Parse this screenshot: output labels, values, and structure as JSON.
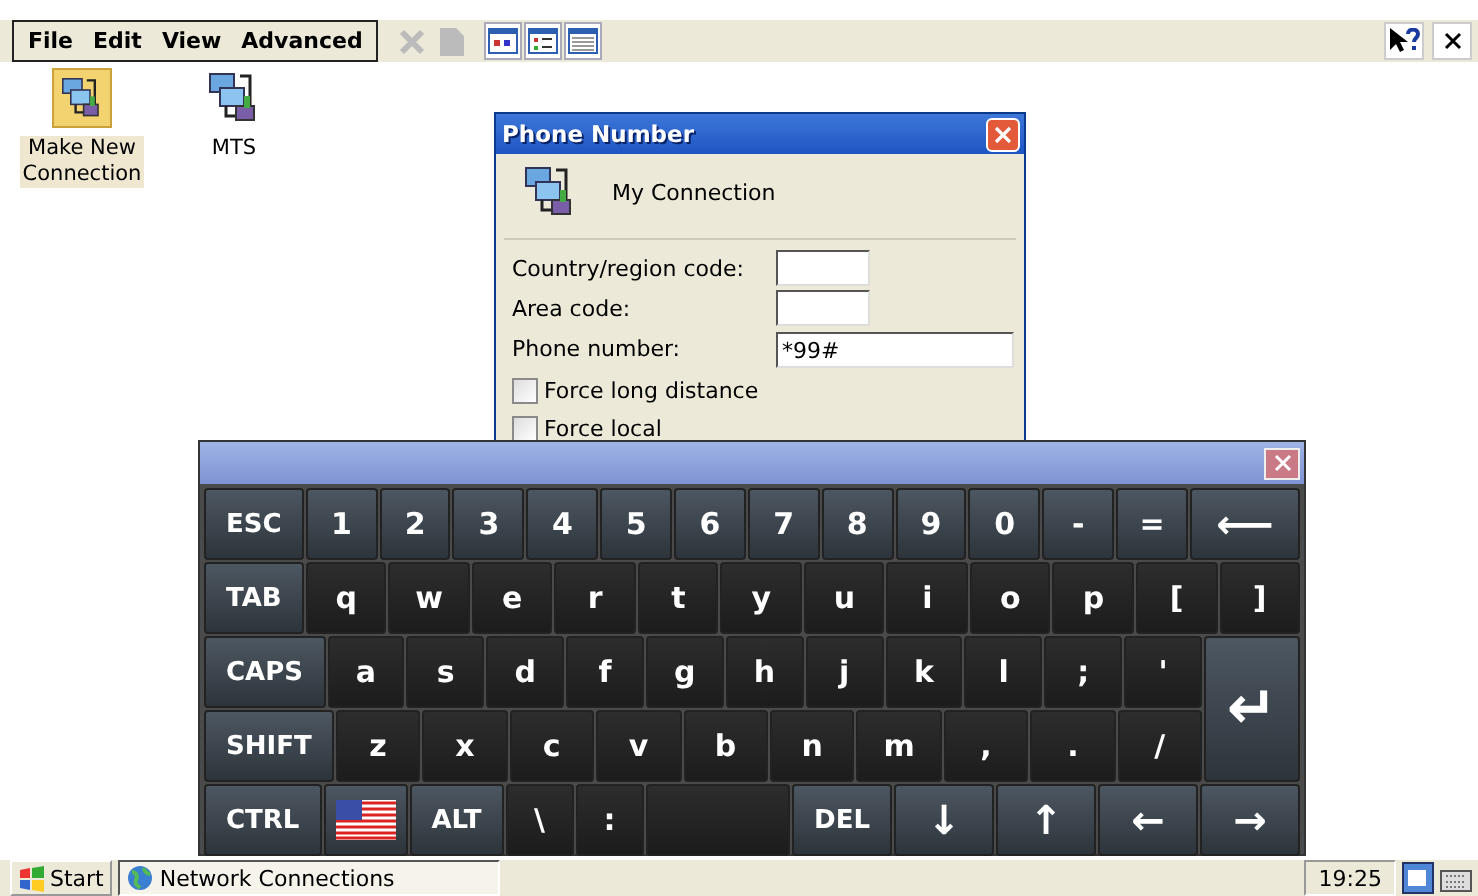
{
  "menu_bar": [
    "File",
    "Edit",
    "View",
    "Advanced"
  ],
  "toolbar": [
    {
      "kind": "delete",
      "disabled": true
    },
    {
      "kind": "properties",
      "disabled": true
    },
    {
      "kind": "large-icons",
      "disabled": false
    },
    {
      "kind": "small-icons",
      "disabled": false
    },
    {
      "kind": "details",
      "disabled": false
    }
  ],
  "desktop_icons": [
    {
      "label": "Make New Connection",
      "kind": "wizard",
      "selected": true
    },
    {
      "label": "MTS",
      "kind": "connection",
      "selected": false
    }
  ],
  "dialog": {
    "title": "Phone Number",
    "connection_name": "My Connection",
    "fields": [
      {
        "label": "Country/region code:",
        "kind": "short"
      },
      {
        "label": "Area code:",
        "kind": "short"
      },
      {
        "label": "Phone number:",
        "value": "*99#",
        "kind": "long"
      }
    ],
    "checkboxes": [
      {
        "label": "Force long distance",
        "checked": false
      },
      {
        "label": "Force local",
        "checked": false
      }
    ]
  },
  "keyboard": {
    "rows": [
      {
        "keys": [
          {
            "label": "ESC",
            "kind": "fn"
          },
          {
            "label": "1",
            "kind": "num"
          },
          {
            "label": "2",
            "kind": "num"
          },
          {
            "label": "3",
            "kind": "num"
          },
          {
            "label": "4",
            "kind": "num"
          },
          {
            "label": "5",
            "kind": "num"
          },
          {
            "label": "6",
            "kind": "num"
          },
          {
            "label": "7",
            "kind": "num"
          },
          {
            "label": "8",
            "kind": "num"
          },
          {
            "label": "9",
            "kind": "num"
          },
          {
            "label": "0",
            "kind": "num"
          },
          {
            "label": "-",
            "kind": "num"
          },
          {
            "label": "=",
            "kind": "num"
          },
          {
            "label": "⟵",
            "kind": "fn"
          }
        ]
      },
      {
        "keys": [
          {
            "label": "TAB",
            "kind": "fn"
          },
          {
            "label": "q",
            "kind": "char"
          },
          {
            "label": "w",
            "kind": "char"
          },
          {
            "label": "e",
            "kind": "char"
          },
          {
            "label": "r",
            "kind": "char"
          },
          {
            "label": "t",
            "kind": "char"
          },
          {
            "label": "y",
            "kind": "char"
          },
          {
            "label": "u",
            "kind": "char"
          },
          {
            "label": "i",
            "kind": "char"
          },
          {
            "label": "o",
            "kind": "char"
          },
          {
            "label": "p",
            "kind": "char"
          },
          {
            "label": "[",
            "kind": "char"
          },
          {
            "label": "]",
            "kind": "char"
          }
        ]
      },
      {
        "keys": [
          {
            "label": "CAPS",
            "kind": "fn"
          },
          {
            "label": "a",
            "kind": "char"
          },
          {
            "label": "s",
            "kind": "char"
          },
          {
            "label": "d",
            "kind": "char"
          },
          {
            "label": "f",
            "kind": "char"
          },
          {
            "label": "g",
            "kind": "char"
          },
          {
            "label": "h",
            "kind": "char"
          },
          {
            "label": "j",
            "kind": "char"
          },
          {
            "label": "k",
            "kind": "char"
          },
          {
            "label": "l",
            "kind": "char"
          },
          {
            "label": ";",
            "kind": "char"
          },
          {
            "label": "'",
            "kind": "char"
          }
        ]
      },
      {
        "keys": [
          {
            "label": "SHIFT",
            "kind": "fn"
          },
          {
            "label": "z",
            "kind": "char"
          },
          {
            "label": "x",
            "kind": "char"
          },
          {
            "label": "c",
            "kind": "char"
          },
          {
            "label": "v",
            "kind": "char"
          },
          {
            "label": "b",
            "kind": "char"
          },
          {
            "label": "n",
            "kind": "char"
          },
          {
            "label": "m",
            "kind": "char"
          },
          {
            "label": ",",
            "kind": "char"
          },
          {
            "label": ".",
            "kind": "char"
          },
          {
            "label": "/",
            "kind": "char"
          }
        ]
      },
      {
        "keys": [
          {
            "label": "CTRL",
            "kind": "fn"
          },
          {
            "kind": "flag"
          },
          {
            "label": "ALT",
            "kind": "fn"
          },
          {
            "label": "\\",
            "kind": "char"
          },
          {
            "label": ":",
            "kind": "char"
          },
          {
            "kind": "space"
          },
          {
            "label": "DEL",
            "kind": "fn"
          },
          {
            "label": "↓",
            "kind": "fn"
          },
          {
            "label": "↑",
            "kind": "fn"
          },
          {
            "label": "←",
            "kind": "fn"
          },
          {
            "label": "→",
            "kind": "fn"
          }
        ]
      }
    ],
    "enter": {
      "label": "↵"
    }
  },
  "taskbar": {
    "start": "Start",
    "tasks": [
      {
        "label": "Network Connections",
        "selected": true
      }
    ],
    "clock": "19:25"
  }
}
